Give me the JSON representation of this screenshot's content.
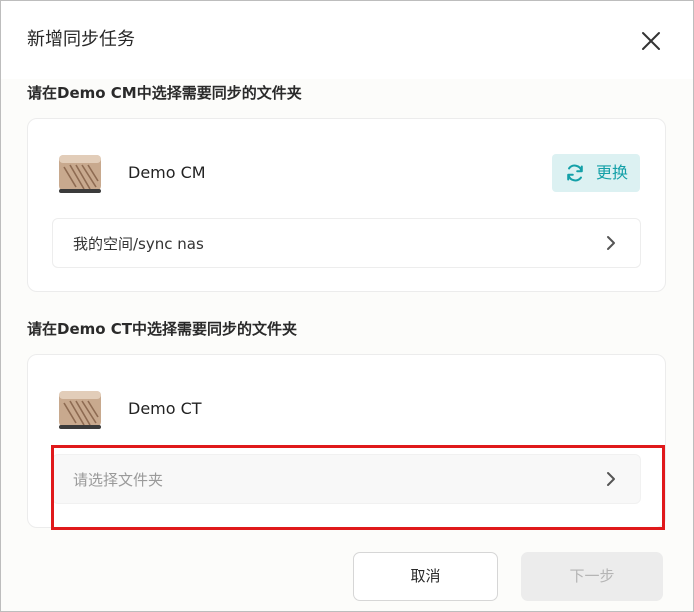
{
  "dialog": {
    "title": "新增同步任务",
    "close_icon": "close-icon"
  },
  "source": {
    "section_title": "请在Demo CM中选择需要同步的文件夹",
    "device_name": "Demo CM",
    "device_icon": "nas-device-icon",
    "change_label": "更换",
    "change_icon": "sync-icon",
    "path_value": "我的空间/sync nas",
    "chevron_icon": "chevron-right-icon"
  },
  "target": {
    "section_title": "请在Demo CT中选择需要同步的文件夹",
    "device_name": "Demo CT",
    "device_icon": "nas-device-icon",
    "path_placeholder": "请选择文件夹",
    "chevron_icon": "chevron-right-icon"
  },
  "footer": {
    "cancel_label": "取消",
    "next_label": "下一步"
  },
  "colors": {
    "accent": "#14a0a8",
    "accent_bg": "#dcf1f2",
    "highlight": "#e0191b",
    "disabled_bg": "#ececec",
    "disabled_text": "#b5b5b5"
  }
}
